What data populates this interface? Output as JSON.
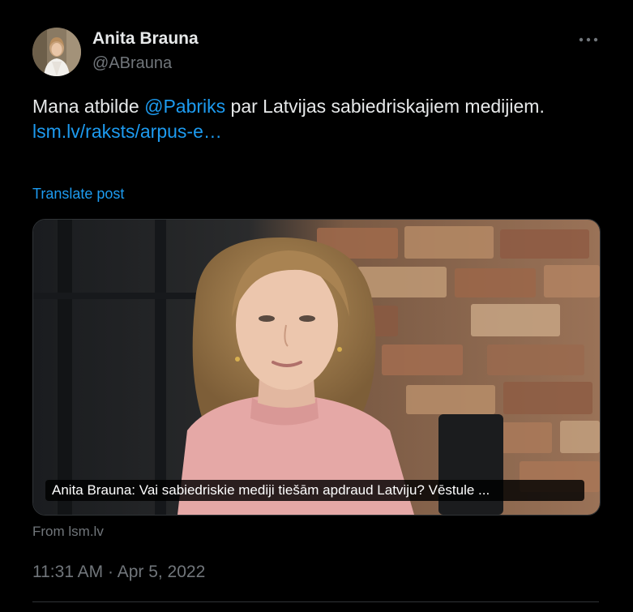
{
  "author": {
    "display_name": "Anita Brauna",
    "handle": "@ABrauna"
  },
  "tweet": {
    "text_before": "Mana atbilde ",
    "mention": "@Pabriks",
    "text_after": " par Latvijas sabiedriskajiem medijiem.",
    "link": "lsm.lv/raksts/arpus-e…",
    "translate_label": "Translate post"
  },
  "card": {
    "caption": "Anita Brauna: Vai sabiedriskie mediji tiešām apdraud Latviju? Vēstule ..."
  },
  "source_label": "From lsm.lv",
  "timestamp": {
    "time": "11:31 AM",
    "separator": " · ",
    "date": "Apr 5, 2022"
  },
  "icons": {
    "more": "more-dots-icon"
  },
  "colors": {
    "background": "#000000",
    "text": "#e7e9ea",
    "secondary": "#71767b",
    "accent": "#1d9bf0"
  }
}
